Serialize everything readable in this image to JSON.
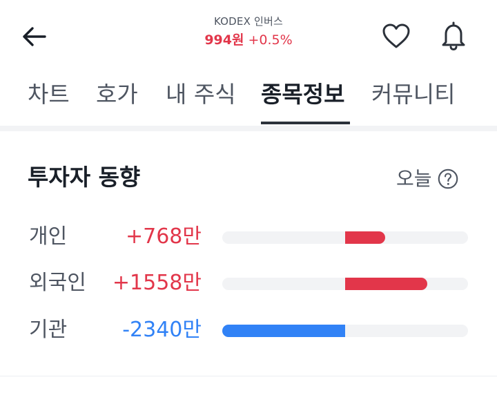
{
  "header": {
    "stock_name": "KODEX 인버스",
    "price": "994원",
    "change": "+0.5%"
  },
  "tabs": [
    {
      "label": "차트"
    },
    {
      "label": "호가"
    },
    {
      "label": "내 주식"
    },
    {
      "label": "종목정보",
      "active": true
    },
    {
      "label": "커뮤니티"
    }
  ],
  "investor_trend": {
    "title": "투자자 동향",
    "period_label": "오늘",
    "rows": [
      {
        "label": "개인",
        "value": "+768만",
        "amount": 768,
        "direction": "buy"
      },
      {
        "label": "외국인",
        "value": "+1558만",
        "amount": 1558,
        "direction": "buy"
      },
      {
        "label": "기관",
        "value": "-2340만",
        "amount": -2340,
        "direction": "sell"
      }
    ],
    "scale_max": 2340
  },
  "colors": {
    "positive": "#e2364a",
    "negative": "#3182f6",
    "track": "#f2f3f5",
    "text_primary": "#191f28",
    "text_secondary": "#4e5561"
  },
  "icons": {
    "back": "arrow-left-icon",
    "favorite": "heart-icon",
    "notification": "bell-icon",
    "help": "question-circle-icon"
  }
}
